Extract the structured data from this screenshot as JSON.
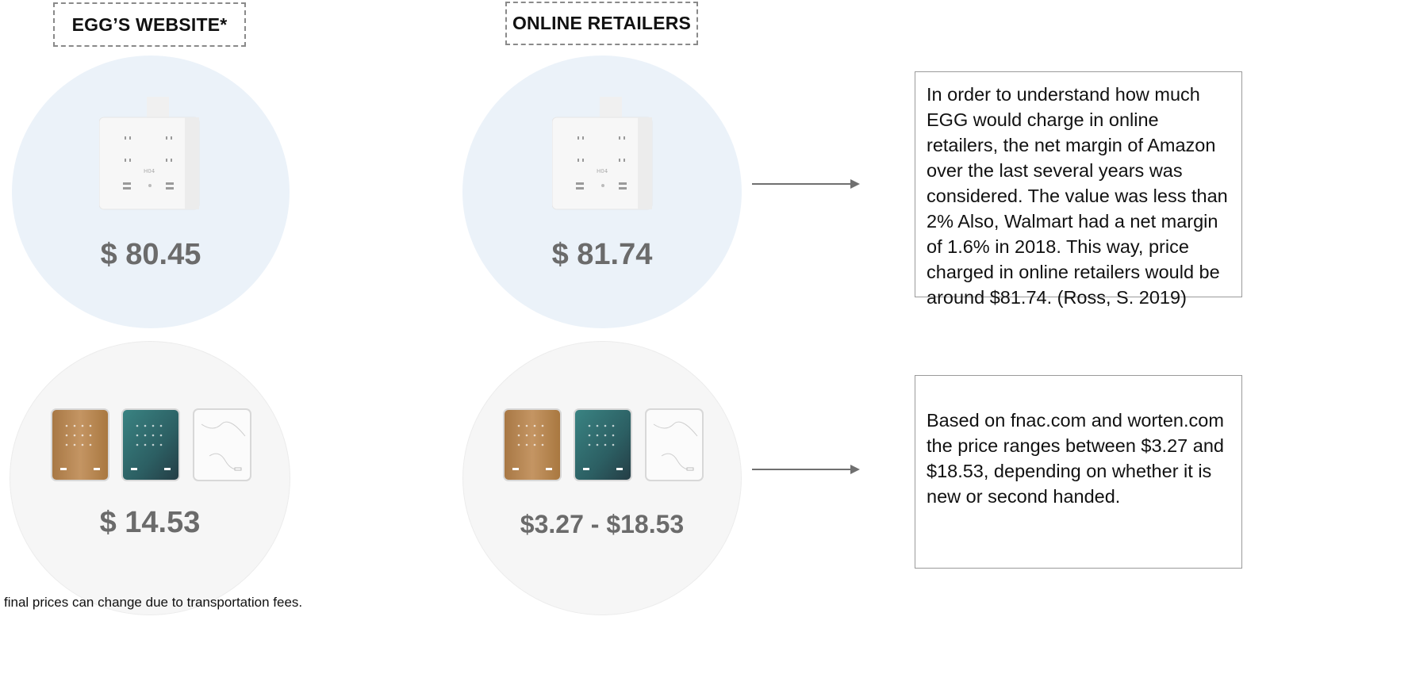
{
  "header": {
    "left_label": "EGG’S WEBSITE*",
    "right_label": "ONLINE RETAILERS"
  },
  "products": {
    "hub_egg_price": "$ 80.45",
    "hub_retail_price": "$ 81.74",
    "cover_egg_price": "$ 14.53",
    "cover_retail_price": "$3.27 - $18.53"
  },
  "notes": {
    "hub_note": "In order to understand how much EGG would charge in online retailers, the net margin of Amazon over the last several years was considered. The value was less than 2% Also, Walmart had a net margin of 1.6% in 2018. This way, price charged in online retailers would be around $81.74. (Ross, S. 2019)",
    "cover_note": "Based on fnac.com and worten.com the price ranges between $3.27 and $18.53, depending on whether it is new or second handed."
  },
  "footnote": "final prices can change due to transportation fees.",
  "colors": {
    "circle_blue": "#ebf2f9",
    "circle_gray": "#f6f6f6",
    "price_gray": "#6b6b6b",
    "wood": "#b98a55",
    "teal": "#2f6b6a"
  },
  "icons": {
    "hub": "power-hub-icon",
    "covers": "switch-cover-icon"
  }
}
